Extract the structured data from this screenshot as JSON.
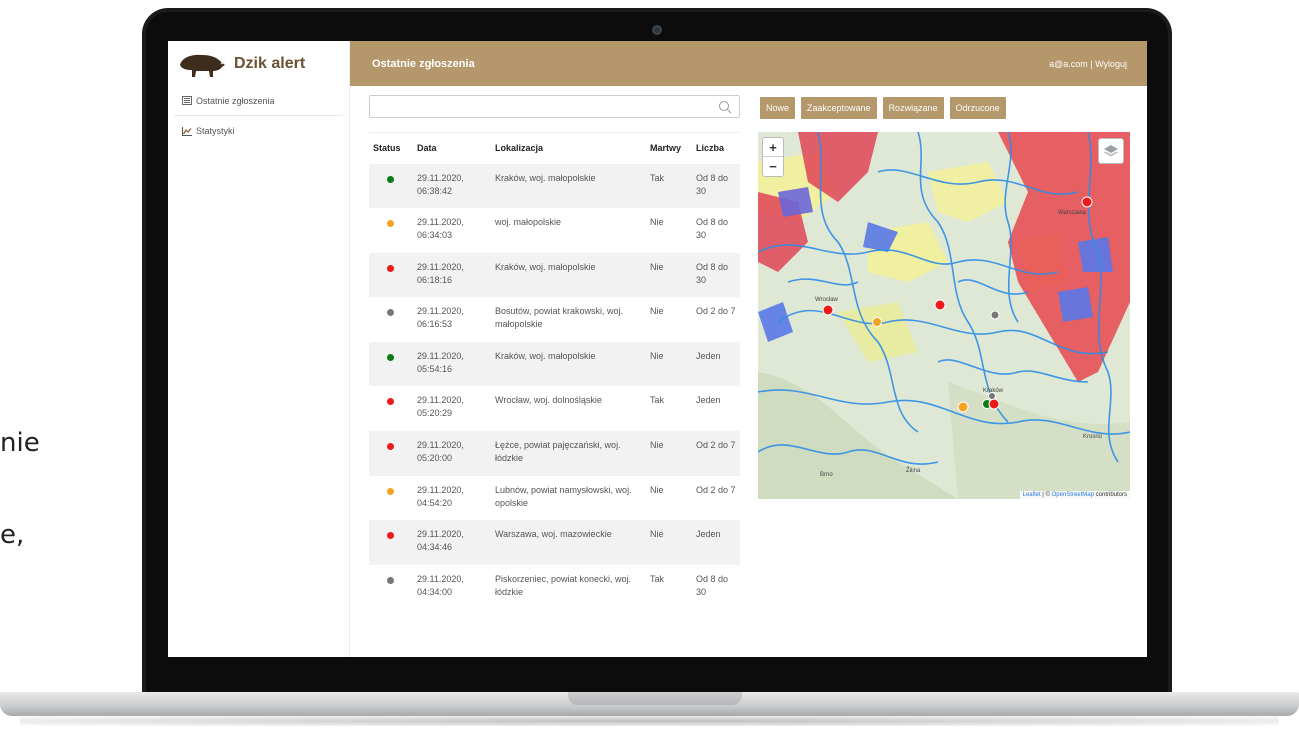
{
  "background_text": {
    "line1": "nie",
    "line2": "e,"
  },
  "app": {
    "name": "Dzik alert"
  },
  "sidebar": {
    "items": [
      {
        "label": "Ostatnie zgłoszenia",
        "icon": "list-icon"
      },
      {
        "label": "Statystyki",
        "icon": "chart-icon"
      }
    ]
  },
  "topbar": {
    "title": "Ostatnie zgłoszenia",
    "user": "a@a.com | Wyloguj"
  },
  "search": {
    "placeholder": "",
    "value": ""
  },
  "filters": {
    "nowe": "Nowe",
    "zaakceptowane": "Zaakceptowane",
    "rozwiazane": "Rozwiązane",
    "odrzucone": "Odrzucone"
  },
  "table": {
    "headers": {
      "status": "Status",
      "data": "Data",
      "lokalizacja": "Lokalizacja",
      "martwy": "Martwy",
      "liczba": "Liczba"
    },
    "rows": [
      {
        "status": "green",
        "date": "29.11.2020,",
        "time": "06:38:42",
        "location": "Kraków, woj. małopolskie",
        "dead": "Tak",
        "count": "Od 8 do 30"
      },
      {
        "status": "orange",
        "date": "29.11.2020,",
        "time": "06:34:03",
        "location": "woj. małopolskie",
        "dead": "Nie",
        "count": "Od 8 do 30"
      },
      {
        "status": "red",
        "date": "29.11.2020,",
        "time": "06:18:16",
        "location": "Kraków, woj. małopolskie",
        "dead": "Nie",
        "count": "Od 8 do 30"
      },
      {
        "status": "gray",
        "date": "29.11.2020,",
        "time": "06:16:53",
        "location": "Bosutów, powiat krakowski, woj. małopolskie",
        "dead": "Nie",
        "count": "Od 2 do 7"
      },
      {
        "status": "green",
        "date": "29.11.2020,",
        "time": "05:54:16",
        "location": "Kraków, woj. małopolskie",
        "dead": "Nie",
        "count": "Jeden"
      },
      {
        "status": "red",
        "date": "29.11.2020,",
        "time": "05:20:29",
        "location": "Wrocław, woj. dolnośląskie",
        "dead": "Tak",
        "count": "Jeden"
      },
      {
        "status": "red",
        "date": "29.11.2020,",
        "time": "05:20:00",
        "location": "Łężce, powiat pajęczański, woj. łódzkie",
        "dead": "Nie",
        "count": "Od 2 do 7"
      },
      {
        "status": "orange",
        "date": "29.11.2020,",
        "time": "04:54:20",
        "location": "Lubnów, powiat namysłowski, woj. opolskie",
        "dead": "Nie",
        "count": "Od 2 do 7"
      },
      {
        "status": "red",
        "date": "29.11.2020,",
        "time": "04:34:46",
        "location": "Warszawa, woj. mazowieckie",
        "dead": "Nie",
        "count": "Jeden"
      },
      {
        "status": "gray",
        "date": "29.11.2020,",
        "time": "04:34:00",
        "location": "Piskorzeniec, powiat konecki, woj. łódzkie",
        "dead": "Tak",
        "count": "Od 8 do 30"
      }
    ]
  },
  "map": {
    "zoom_in": "+",
    "zoom_out": "−",
    "attribution_leaflet": "Leaflet",
    "attribution_sep": " | © ",
    "attribution_osm": "OpenStreetMap",
    "attribution_tail": " contributors",
    "labels": {
      "warszawa": "Warszawa",
      "wroclaw": "Wrocław",
      "krakow": "Kraków",
      "brno": "Brno",
      "zilina": "Žilina",
      "kosice": "Krosno"
    }
  },
  "colors": {
    "accent": "#b4976a",
    "green": "#0a7a14",
    "orange": "#f4a21f",
    "red": "#ee1a1a",
    "gray": "#777777"
  }
}
